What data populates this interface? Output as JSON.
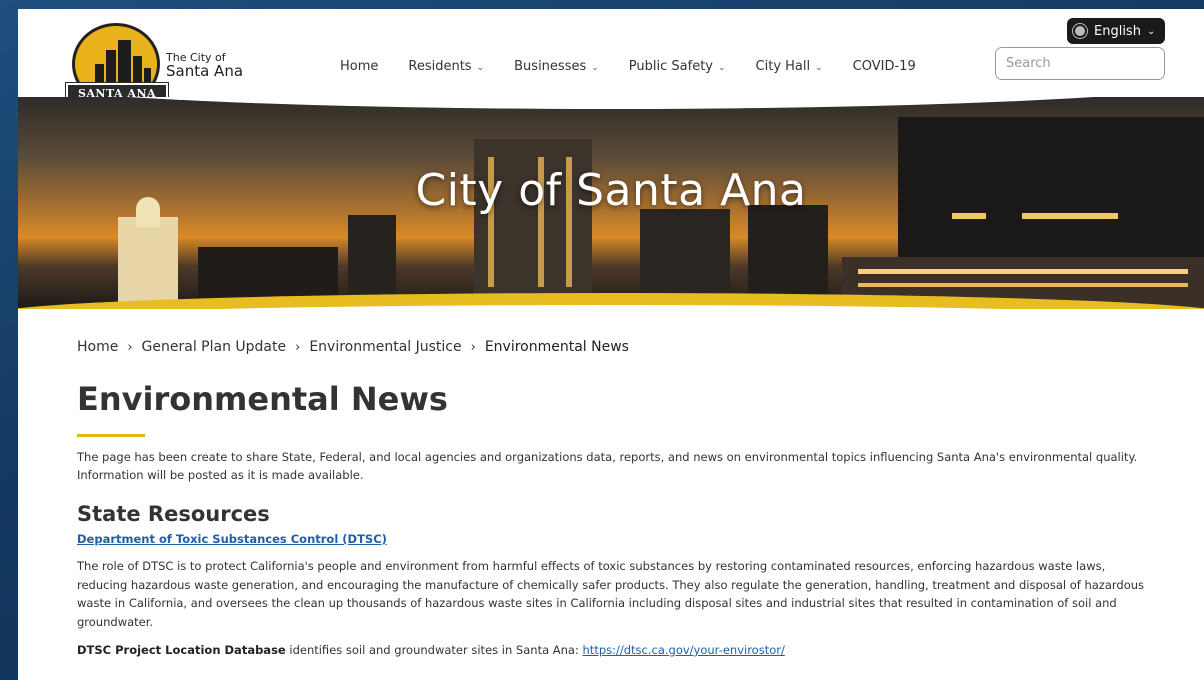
{
  "header": {
    "logo_banner_text": "SANTA ANA",
    "brand_small": "The City of",
    "brand_big": "Santa Ana",
    "nav": [
      {
        "label": "Home",
        "dropdown": false
      },
      {
        "label": "Residents",
        "dropdown": true
      },
      {
        "label": "Businesses",
        "dropdown": true
      },
      {
        "label": "Public Safety",
        "dropdown": true
      },
      {
        "label": "City Hall",
        "dropdown": true
      },
      {
        "label": "COVID-19",
        "dropdown": false
      }
    ],
    "language": "English",
    "search_placeholder": "Search"
  },
  "hero": {
    "title": "City of Santa Ana"
  },
  "breadcrumb": [
    "Home",
    "General Plan Update",
    "Environmental Justice",
    "Environmental News"
  ],
  "page": {
    "title": "Environmental News",
    "intro": "The page has been create to share State, Federal, and local agencies and organizations data, reports, and news on environmental topics influencing Santa Ana's environmental quality. Information will be posted as it is made available.",
    "section_title": "State Resources",
    "section_link": "Department of Toxic Substances Control (DTSC)",
    "description": "The role of DTSC is to protect California's people and environment from harmful effects of toxic substances by restoring contaminated resources, enforcing hazardous waste laws, reducing hazardous waste generation, and encouraging the manufacture of chemically safer products. They also regulate the generation, handling, treatment and disposal of hazardous waste in California, and oversees the clean up thousands of hazardous waste sites in California including disposal sites and industrial sites that resulted in contamination of soil and groundwater.",
    "db_bold": "DTSC Project Location Database",
    "db_text": " identifies soil and groundwater sites in Santa Ana: ",
    "db_link": "https://dtsc.ca.gov/your-envirostor/"
  },
  "colors": {
    "accent_gold": "#e8bd22",
    "link_blue": "#1f5fa8",
    "dark": "#1c1c1c"
  }
}
